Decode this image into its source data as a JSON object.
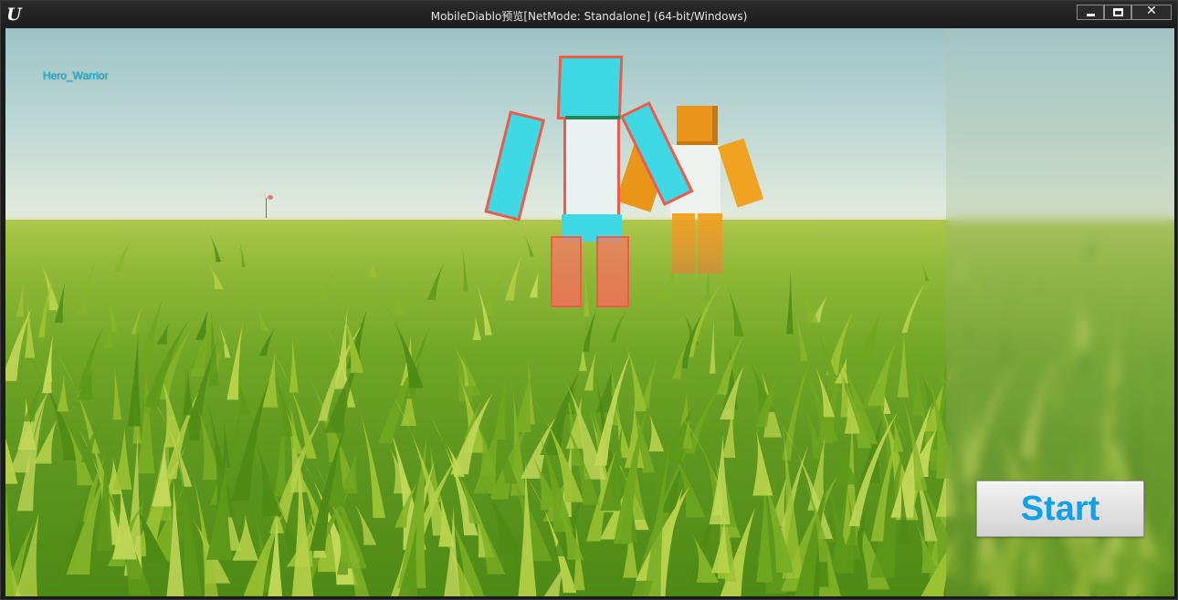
{
  "window": {
    "title": "MobileDiablo预览[NetMode: Standalone]  (64-bit/Windows)",
    "app_icon": "unreal-engine-icon",
    "controls": {
      "minimize_icon": "minimize-icon",
      "maximize_icon": "maximize-icon",
      "close_icon": "close-icon",
      "close_glyph": "✕"
    }
  },
  "hud": {
    "hero_label": "Hero_Warrior"
  },
  "buttons": {
    "start_label": "Start"
  },
  "colors": {
    "hero_primary": "#3fd9e6",
    "hero_outline": "#f05a4a",
    "companion_primary": "#e8951a",
    "start_text": "#12a0e8",
    "label_text": "#1ab4d3"
  }
}
